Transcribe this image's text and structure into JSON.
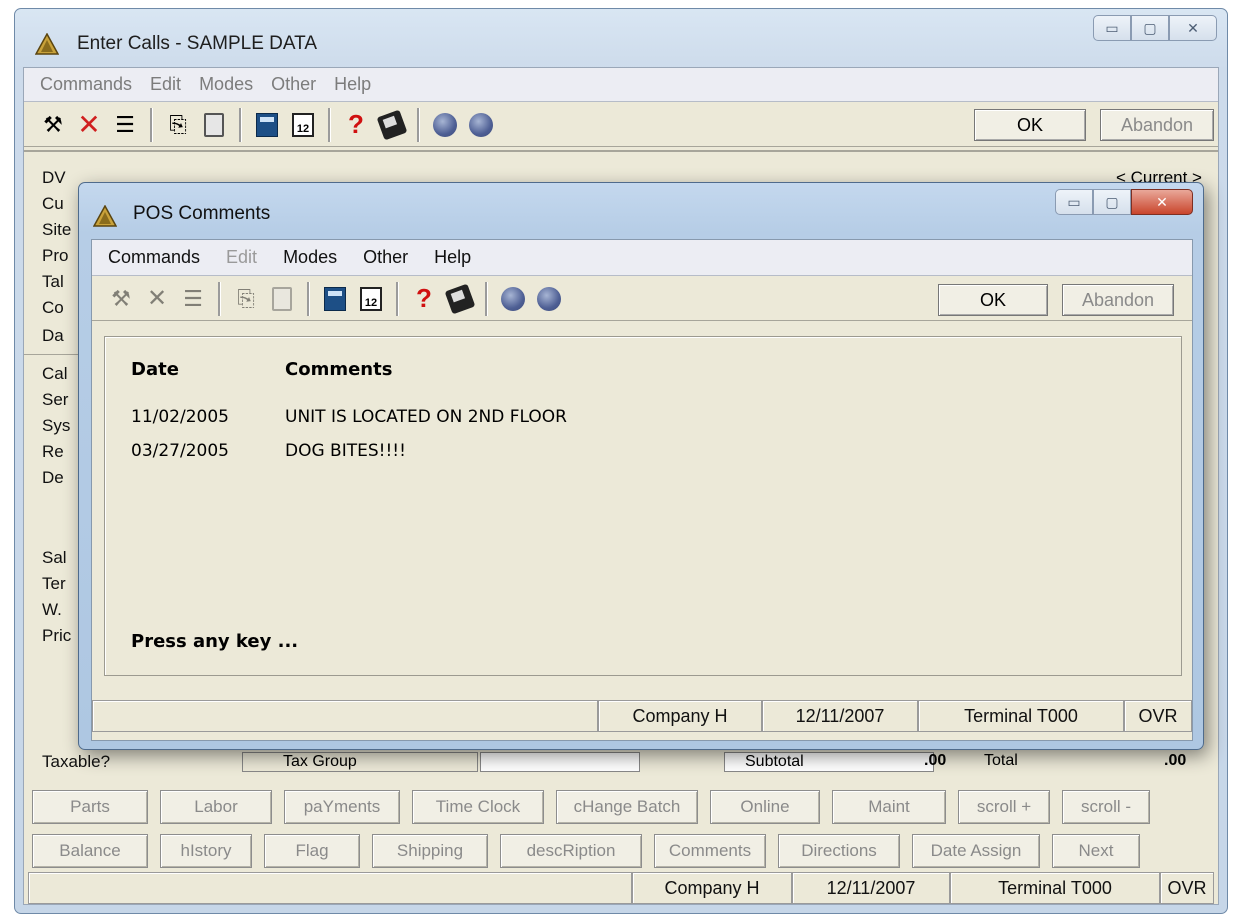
{
  "outer": {
    "title": "Enter Calls - SAMPLE DATA",
    "menu": [
      "Commands",
      "Edit",
      "Modes",
      "Other",
      "Help"
    ],
    "ok_label": "OK",
    "abandon_label": "Abandon",
    "current_label": "< Current >",
    "side_labels": [
      "DV",
      "Cu",
      "Site",
      "Pro",
      "Tal",
      "Co",
      "Da",
      "Cal",
      "Ser",
      "Sys",
      "Re",
      "De",
      "Sal",
      "Ter",
      "W.",
      "Pric",
      "Taxable?"
    ],
    "bottom_strip": [
      "Tax Group",
      "Subtotal",
      ".00",
      "Total",
      ".00"
    ],
    "buttons_row1": [
      "Parts",
      "Labor",
      "paYments",
      "Time Clock",
      "cHange Batch",
      "Online",
      "Maint",
      "scroll +",
      "scroll -"
    ],
    "buttons_row2": [
      "Balance",
      "hIstory",
      "Flag",
      "Shipping",
      "descRiption",
      "Comments",
      "Directions",
      "Date Assign",
      "Next"
    ],
    "status": {
      "company": "Company H",
      "date": "12/11/2007",
      "terminal": "Terminal T000",
      "mode": "OVR"
    }
  },
  "dialog": {
    "title": "POS Comments",
    "menu": [
      {
        "label": "Commands",
        "enabled": true
      },
      {
        "label": "Edit",
        "enabled": false
      },
      {
        "label": "Modes",
        "enabled": true
      },
      {
        "label": "Other",
        "enabled": true
      },
      {
        "label": "Help",
        "enabled": true
      }
    ],
    "ok_label": "OK",
    "abandon_label": "Abandon",
    "columns": {
      "date": "Date",
      "comments": "Comments"
    },
    "rows": [
      {
        "date": "11/02/2005",
        "comment": "UNIT IS LOCATED ON 2ND FLOOR"
      },
      {
        "date": "03/27/2005",
        "comment": "DOG BITES!!!!"
      }
    ],
    "prompt": "Press any key ...",
    "status": {
      "company": "Company H",
      "date": "12/11/2007",
      "terminal": "Terminal T000",
      "mode": "OVR"
    }
  },
  "icons": {
    "tools": "tools-icon",
    "delete": "delete-icon",
    "list": "list-icon",
    "copy": "copy-icon",
    "paste": "paste-icon",
    "calculator": "calculator-icon",
    "calendar": "calendar-icon",
    "help": "help-icon",
    "book": "book-icon",
    "globe": "globe-icon"
  },
  "calendar_number": "12"
}
